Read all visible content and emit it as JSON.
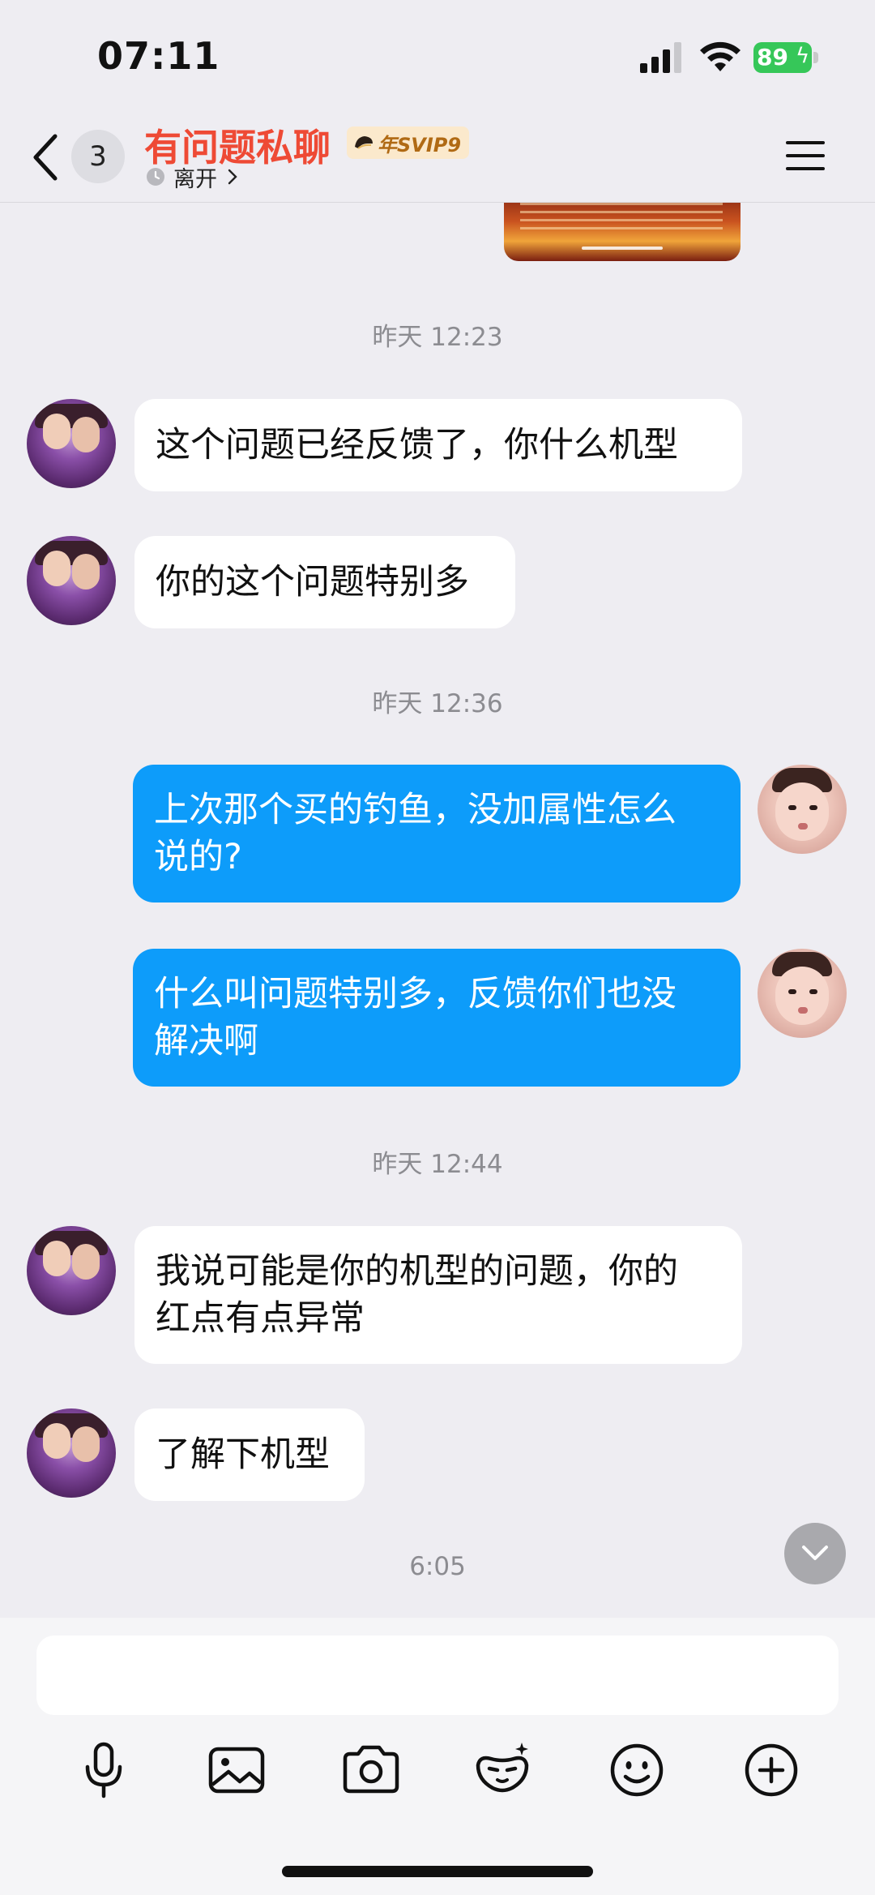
{
  "status_bar": {
    "time": "07:11",
    "battery": "89"
  },
  "header": {
    "unread_count": "3",
    "title": "有问题私聊",
    "vip_label": "年SVIP9",
    "presence": "离开"
  },
  "messages": [
    {
      "type": "timestamp",
      "text": "昨天 12:23"
    },
    {
      "type": "incoming",
      "text": "这个问题已经反馈了，你什么机型"
    },
    {
      "type": "incoming",
      "text": "你的这个问题特别多"
    },
    {
      "type": "timestamp",
      "text": "昨天 12:36"
    },
    {
      "type": "outgoing",
      "lines": [
        "上次那个买的钓鱼，没加属性怎么",
        "说的?"
      ]
    },
    {
      "type": "outgoing",
      "lines": [
        "什么叫问题特别多，反馈你们也没",
        "解决啊"
      ]
    },
    {
      "type": "timestamp",
      "text": "昨天 12:44"
    },
    {
      "type": "incoming",
      "lines": [
        "我说可能是你的机型的问题，你的",
        "红点有点异常"
      ]
    },
    {
      "type": "incoming",
      "text": "了解下机型"
    },
    {
      "type": "timestamp",
      "text": "6:05"
    }
  ],
  "input": {
    "value": "",
    "placeholder": ""
  },
  "toolbar_icons": [
    "microphone-icon",
    "image-icon",
    "camera-icon",
    "sticker-icon",
    "emoji-icon",
    "plus-icon"
  ],
  "colors": {
    "title": "#ee4a35",
    "outgoing_bubble": "#0d9cfa",
    "incoming_bubble": "#ffffff",
    "background": "#eeedf2",
    "battery": "#36c759"
  }
}
